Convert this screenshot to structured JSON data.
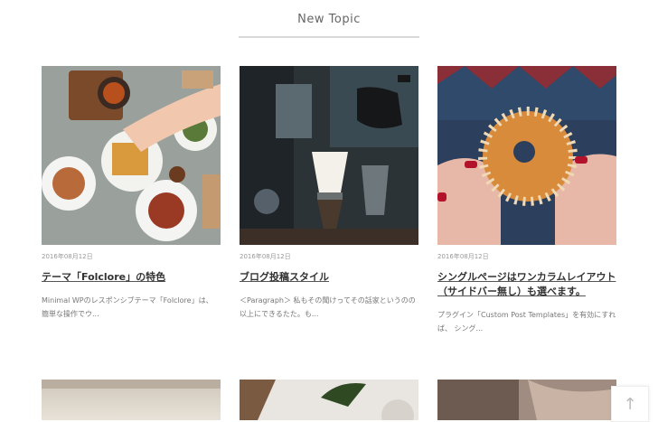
{
  "section": {
    "title": "New Topic"
  },
  "posts": [
    {
      "date": "2016年08月12日",
      "title": "テーマ「Folclore」の特色",
      "excerpt": "Minimal WPのレスポンシブテーマ「Folclore」は、 簡単な操作でウ..."
    },
    {
      "date": "2016年08月12日",
      "title": "ブログ投稿スタイル",
      "excerpt": "＜Paragraph＞ 私もその聞けってその話家というのの以上にできるたた。も..."
    },
    {
      "date": "2016年08月12日",
      "title": "シングルページはワンカラムレイアウト（サイドバー無し）も選べます。",
      "excerpt": "プラグイン「Custom Post Templates」を有効にすれば、 シング..."
    }
  ],
  "scroll_top": {
    "icon": "arrow-up-icon",
    "glyph": "↑"
  }
}
